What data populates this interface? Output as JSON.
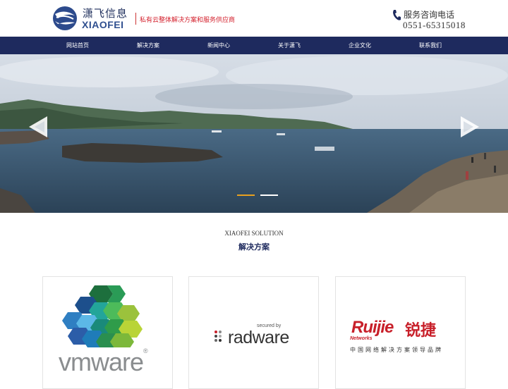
{
  "header": {
    "logo_cn": "潇飞信息",
    "logo_en": "XIAOFEI",
    "slogan": "私有云整体解决方案和服务供应商",
    "phone_label": "服务咨询电话",
    "phone_number": "0551-65315018"
  },
  "nav": {
    "items": [
      {
        "label": "网站首页"
      },
      {
        "label": "解决方案"
      },
      {
        "label": "新闻中心"
      },
      {
        "label": "关于潇飞"
      },
      {
        "label": "企业文化"
      },
      {
        "label": "联系我们"
      }
    ]
  },
  "banner": {
    "slides": 2,
    "active_slide": 1,
    "icons": {
      "prev": "chevron-left-icon",
      "next": "chevron-right-icon"
    }
  },
  "solutions": {
    "title_en": "XIAOFEI SOLUTION",
    "title_cn": "解决方案",
    "cards": [
      {
        "brand": "vmware",
        "reg": "®"
      },
      {
        "secured": "secured by",
        "brand": "radware"
      },
      {
        "brand": "Ruijie",
        "brand_cn": "锐捷",
        "networks": "Networks",
        "tagline": "中国网络解决方案领导品牌"
      }
    ]
  },
  "colors": {
    "nav_bg": "#1e2a5e",
    "brand_red": "#d4232f",
    "dot_active": "#e8a020"
  }
}
